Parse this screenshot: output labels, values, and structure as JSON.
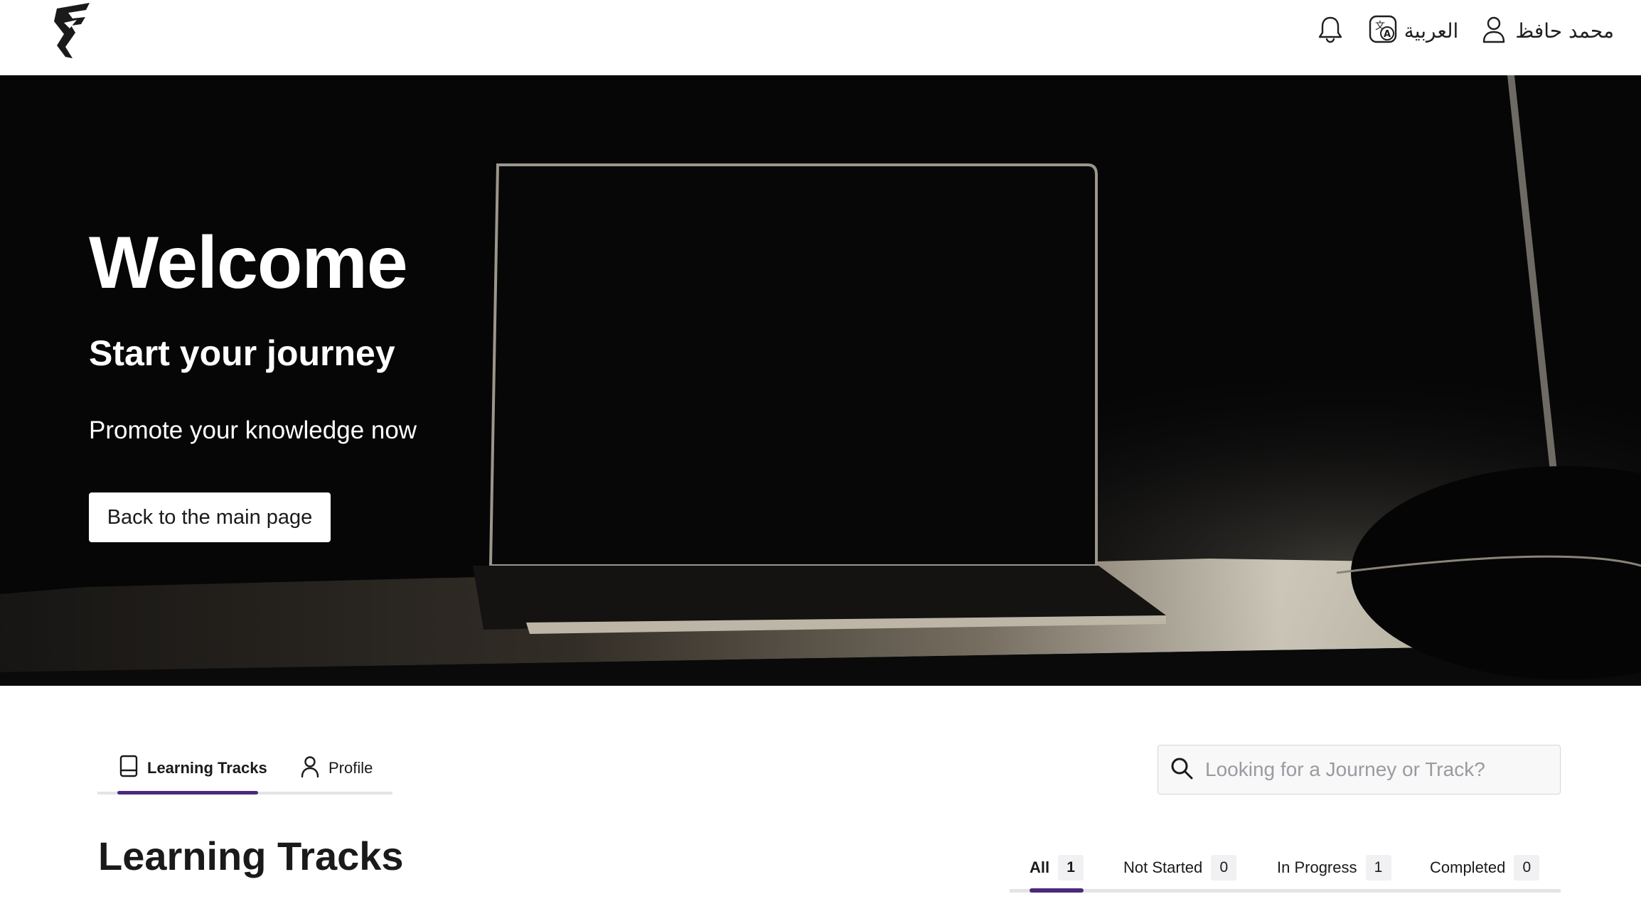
{
  "header": {
    "language_label": "العربية",
    "user_name": "محمد حافظ",
    "icons": [
      "logo-icon",
      "bell-icon",
      "translate-icon",
      "user-icon"
    ]
  },
  "hero": {
    "title": "Welcome",
    "subtitle": "Start your journey",
    "text": "Promote your knowledge now",
    "button_label": "Back to the main page"
  },
  "profile_tabs": {
    "items": [
      {
        "label": "Learning Tracks",
        "icon": "tablet-icon",
        "active": true
      },
      {
        "label": "Profile",
        "icon": "user-icon",
        "active": false
      }
    ]
  },
  "search": {
    "placeholder": "Looking for a Journey or Track?",
    "value": ""
  },
  "section": {
    "title": "Learning Tracks"
  },
  "status_tabs": {
    "items": [
      {
        "label": "All",
        "count": "1",
        "active": true
      },
      {
        "label": "Not Started",
        "count": "0",
        "active": false
      },
      {
        "label": "In Progress",
        "count": "1",
        "active": false
      },
      {
        "label": "Completed",
        "count": "0",
        "active": false
      }
    ]
  },
  "colors": {
    "accent": "#4b2a7b",
    "hero_background": "#050506",
    "tab_track": "#e4e4e7"
  }
}
